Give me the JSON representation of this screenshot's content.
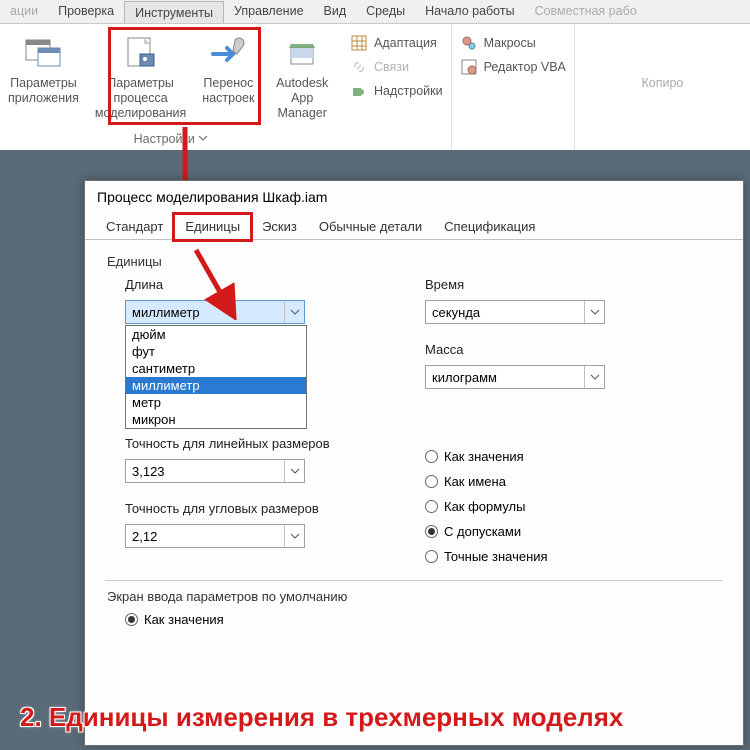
{
  "menu": {
    "items": [
      "ации",
      "Проверка",
      "Инструменты",
      "Управление",
      "Вид",
      "Среды",
      "Начало работы",
      "Совместная рабо"
    ],
    "active_index": 2
  },
  "ribbon": {
    "app_params": "Параметры приложения",
    "process_params": "Параметры процесса моделирования",
    "transfer": "Перенос настроек",
    "autodesk": "Autodesk App Manager",
    "adapt": "Адаптация",
    "svyazi": "Связи",
    "addons": "Надстройки",
    "macros": "Макросы",
    "vba": "Редактор VBA",
    "panel_name": "Настройки",
    "copy": "Копиро"
  },
  "dialog": {
    "title": "Процесс моделирования Шкаф.iam",
    "tabs": [
      "Стандарт",
      "Единицы",
      "Эскиз",
      "Обычные детали",
      "Спецификация"
    ],
    "active_tab": 1,
    "units_label": "Единицы",
    "length_label": "Длина",
    "length_value": "миллиметр",
    "length_options": [
      "дюйм",
      "фут",
      "сантиметр",
      "миллиметр",
      "метр",
      "микрон"
    ],
    "time_label": "Время",
    "time_value": "секунда",
    "mass_label": "Масса",
    "mass_value": "килограмм",
    "linear_precision_label": "Точность для линейных размеров",
    "linear_precision_value": "3,123",
    "angular_precision_label": "Точность для угловых размеров",
    "angular_precision_value": "2,12",
    "display_options": [
      "Как значения",
      "Как имена",
      "Как формулы",
      "С допусками",
      "Точные значения"
    ],
    "display_selected": 3,
    "default_input_label": "Экран ввода параметров по умолчанию",
    "default_input_option": "Как значения"
  },
  "annotation": "2. Единицы измерения в трехмерных моделях"
}
